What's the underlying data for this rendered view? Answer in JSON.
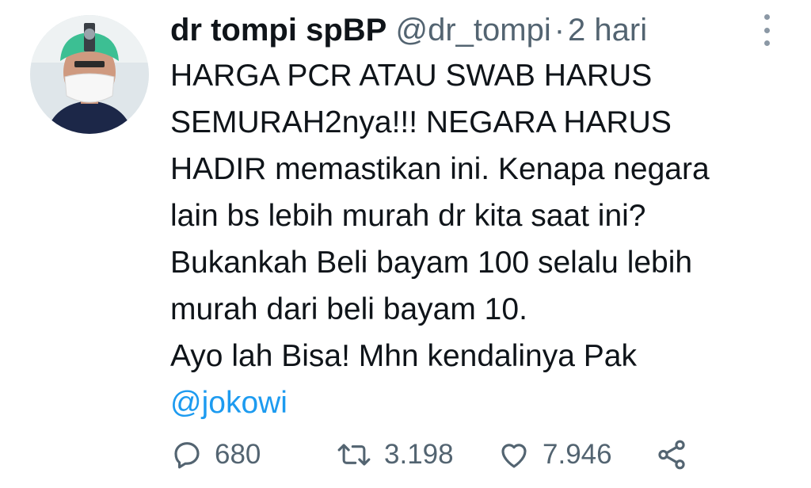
{
  "tweet": {
    "author_name": "dr tompi spBP",
    "author_handle": "@dr_tompi",
    "separator": "·",
    "time": "2 hari",
    "text_lines": [
      "HARGA PCR ATAU SWAB HARUS",
      "SEMURAH2nya!!!  NEGARA HARUS",
      "HADIR memastikan ini. Kenapa negara",
      "lain bs lebih murah dr kita saat ini?",
      "Bukankah Beli bayam 100 selalu lebih",
      "murah dari beli bayam 10.",
      "Ayo lah Bisa! Mhn kendalinya Pak"
    ],
    "mention": "@jokowi",
    "stats": {
      "replies": "680",
      "retweets": "3.198",
      "likes": "7.946"
    }
  },
  "icons": {
    "more": "more-vertical-icon",
    "reply": "reply-icon",
    "retweet": "retweet-icon",
    "like": "heart-icon",
    "share": "share-icon"
  },
  "colors": {
    "text": "#0f1419",
    "secondary": "#536471",
    "link": "#1d9bf0",
    "background": "#ffffff"
  }
}
